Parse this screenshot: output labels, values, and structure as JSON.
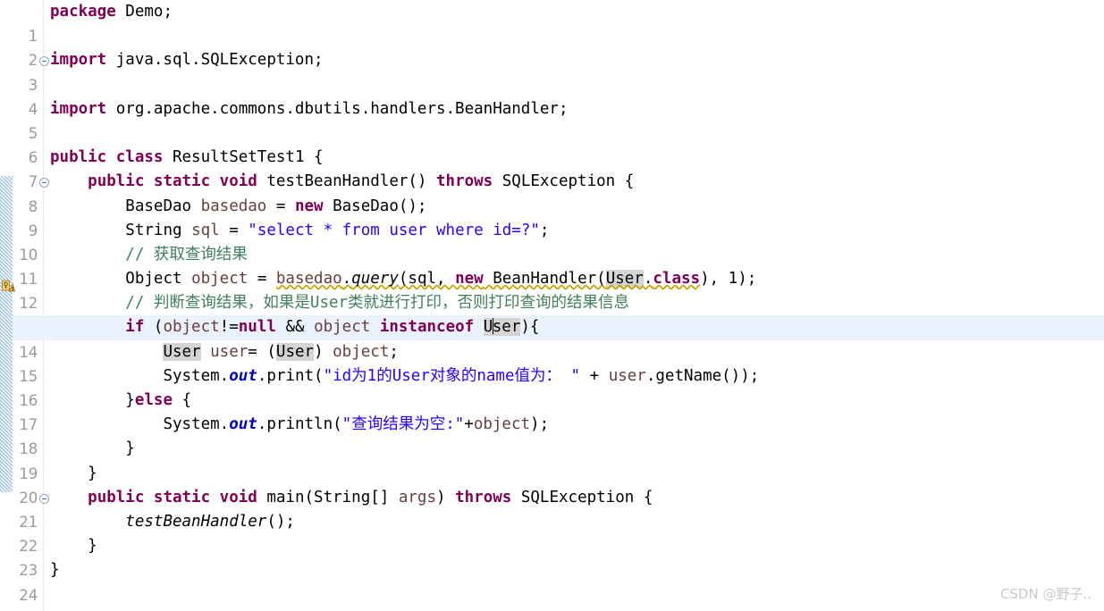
{
  "editor": {
    "language": "java",
    "active_line": 14,
    "colors": {
      "background": "#ffffff",
      "active_line": "#eaf2fd",
      "keyword": "#7f0055",
      "string": "#2a00ff",
      "comment": "#3f7f5f",
      "local_variable": "#6a3e3e",
      "static_field": "#0000c0",
      "occurrence_highlight": "#d4d4d4",
      "warning_squiggle": "#c8a000",
      "line_number": "#9a9a9a",
      "change_bar": "#9dc3e6"
    },
    "gutter": {
      "fold_marker_lines": [
        3,
        8,
        21
      ],
      "warning_icon_lines": [
        12
      ],
      "change_bar_range": [
        8,
        20
      ]
    },
    "lines": [
      {
        "n": 1,
        "text": "package Demo;"
      },
      {
        "n": 2,
        "text": ""
      },
      {
        "n": 3,
        "text": "import java.sql.SQLException;"
      },
      {
        "n": 4,
        "text": ""
      },
      {
        "n": 5,
        "text": "import org.apache.commons.dbutils.handlers.BeanHandler;"
      },
      {
        "n": 6,
        "text": ""
      },
      {
        "n": 7,
        "text": "public class ResultSetTest1 {"
      },
      {
        "n": 8,
        "text": "    public static void testBeanHandler() throws SQLException {"
      },
      {
        "n": 9,
        "text": "        BaseDao basedao = new BaseDao();"
      },
      {
        "n": 10,
        "text": "        String sql = \"select * from user where id=?\";"
      },
      {
        "n": 11,
        "text": "        // 获取查询结果"
      },
      {
        "n": 12,
        "text": "        Object object = basedao.query(sql, new BeanHandler(User.class), 1);"
      },
      {
        "n": 13,
        "text": "        // 判断查询结果，如果是User类就进行打印，否则打印查询的结果信息"
      },
      {
        "n": 14,
        "text": "        if (object!=null && object instanceof User){"
      },
      {
        "n": 15,
        "text": "            User user= (User) object;"
      },
      {
        "n": 16,
        "text": "            System.out.print(\"id为1的User对象的name值为： \" + user.getName());"
      },
      {
        "n": 17,
        "text": "        }else {"
      },
      {
        "n": 18,
        "text": "            System.out.println(\"查询结果为空:\"+object);"
      },
      {
        "n": 19,
        "text": "        }"
      },
      {
        "n": 20,
        "text": "    }"
      },
      {
        "n": 21,
        "text": "    public static void main(String[] args) throws SQLException {"
      },
      {
        "n": 22,
        "text": "        testBeanHandler();"
      },
      {
        "n": 23,
        "text": "    }"
      },
      {
        "n": 24,
        "text": "}"
      }
    ],
    "tokens": {
      "l1": {
        "kw": "package",
        "rest": " Demo;"
      },
      "l3": {
        "kw": "import",
        "rest": " java.sql.SQLException;"
      },
      "l5": {
        "kw": "import",
        "rest": " org.apache.commons.dbutils.handlers.BeanHandler;"
      },
      "l7": {
        "kw1": "public",
        "kw2": "class",
        "name": " ResultSetTest1 {"
      },
      "l8": {
        "mods": "public static void",
        "name": " testBeanHandler() ",
        "throws": "throws",
        "exc": " SQLException {"
      },
      "l9": {
        "type": "BaseDao ",
        "var": "basedao",
        "eq": " = ",
        "kw": "new",
        "ctor": " BaseDao();"
      },
      "l10": {
        "type": "String ",
        "var": "sql",
        "eq": " = ",
        "str": "\"select * from user where id=?\"",
        "end": ";"
      },
      "l11": {
        "comment": "// 获取查询结果"
      },
      "l12": {
        "type": "Object ",
        "var": "object",
        "eq": " = ",
        "recv": "basedao",
        "dot": ".",
        "method": "query",
        "args1": "(sql, ",
        "kw": "new",
        "args2": " BeanHandler(",
        "cls": "User",
        "clsdot": ".",
        "clskw": "class",
        "args3": "), 1);"
      },
      "l13": {
        "comment": "// 判断查询结果，如果是User类就进行打印，否则打印查询的结果信息"
      },
      "l14": {
        "kw": "if",
        "p1": " (",
        "v1": "object",
        "op1": "!=",
        "kwnull": "null",
        "op2": " && ",
        "v2": "object",
        "kwio": " instanceof ",
        "cls_a": "U",
        "cls_b": "ser",
        "end": "){"
      },
      "l15": {
        "cls1": "User",
        "sp1": " ",
        "var": "user",
        "eq": "= (",
        "cls2": "User",
        "sp2": ") ",
        "v": "object",
        "end": ";"
      },
      "l16": {
        "sys": "System",
        "d1": ".",
        "out": "out",
        "d2": ".",
        "call": "print(",
        "str": "\"id为1的User对象的name值为： \"",
        "plus": " + ",
        "var": "user",
        "tail": ".getName());"
      },
      "l17": {
        "brace": "}",
        "kw": "else",
        "end": " {"
      },
      "l18": {
        "sys": "System",
        "d1": ".",
        "out": "out",
        "d2": ".",
        "call": "println(",
        "str": "\"查询结果为空:\"",
        "plus": "+",
        "var": "object",
        "end": ");"
      },
      "l19": {
        "text": "}"
      },
      "l20": {
        "text": "}"
      },
      "l21": {
        "mods": "public static void",
        "name": " main(String[] ",
        "arg": "args",
        "p": ") ",
        "throws": "throws",
        "exc": " SQLException {"
      },
      "l22": {
        "method": "testBeanHandler",
        "end": "();"
      },
      "l23": {
        "text": "}"
      },
      "l24": {
        "text": "}"
      }
    }
  },
  "watermark": {
    "text": "CSDN @野子.."
  }
}
